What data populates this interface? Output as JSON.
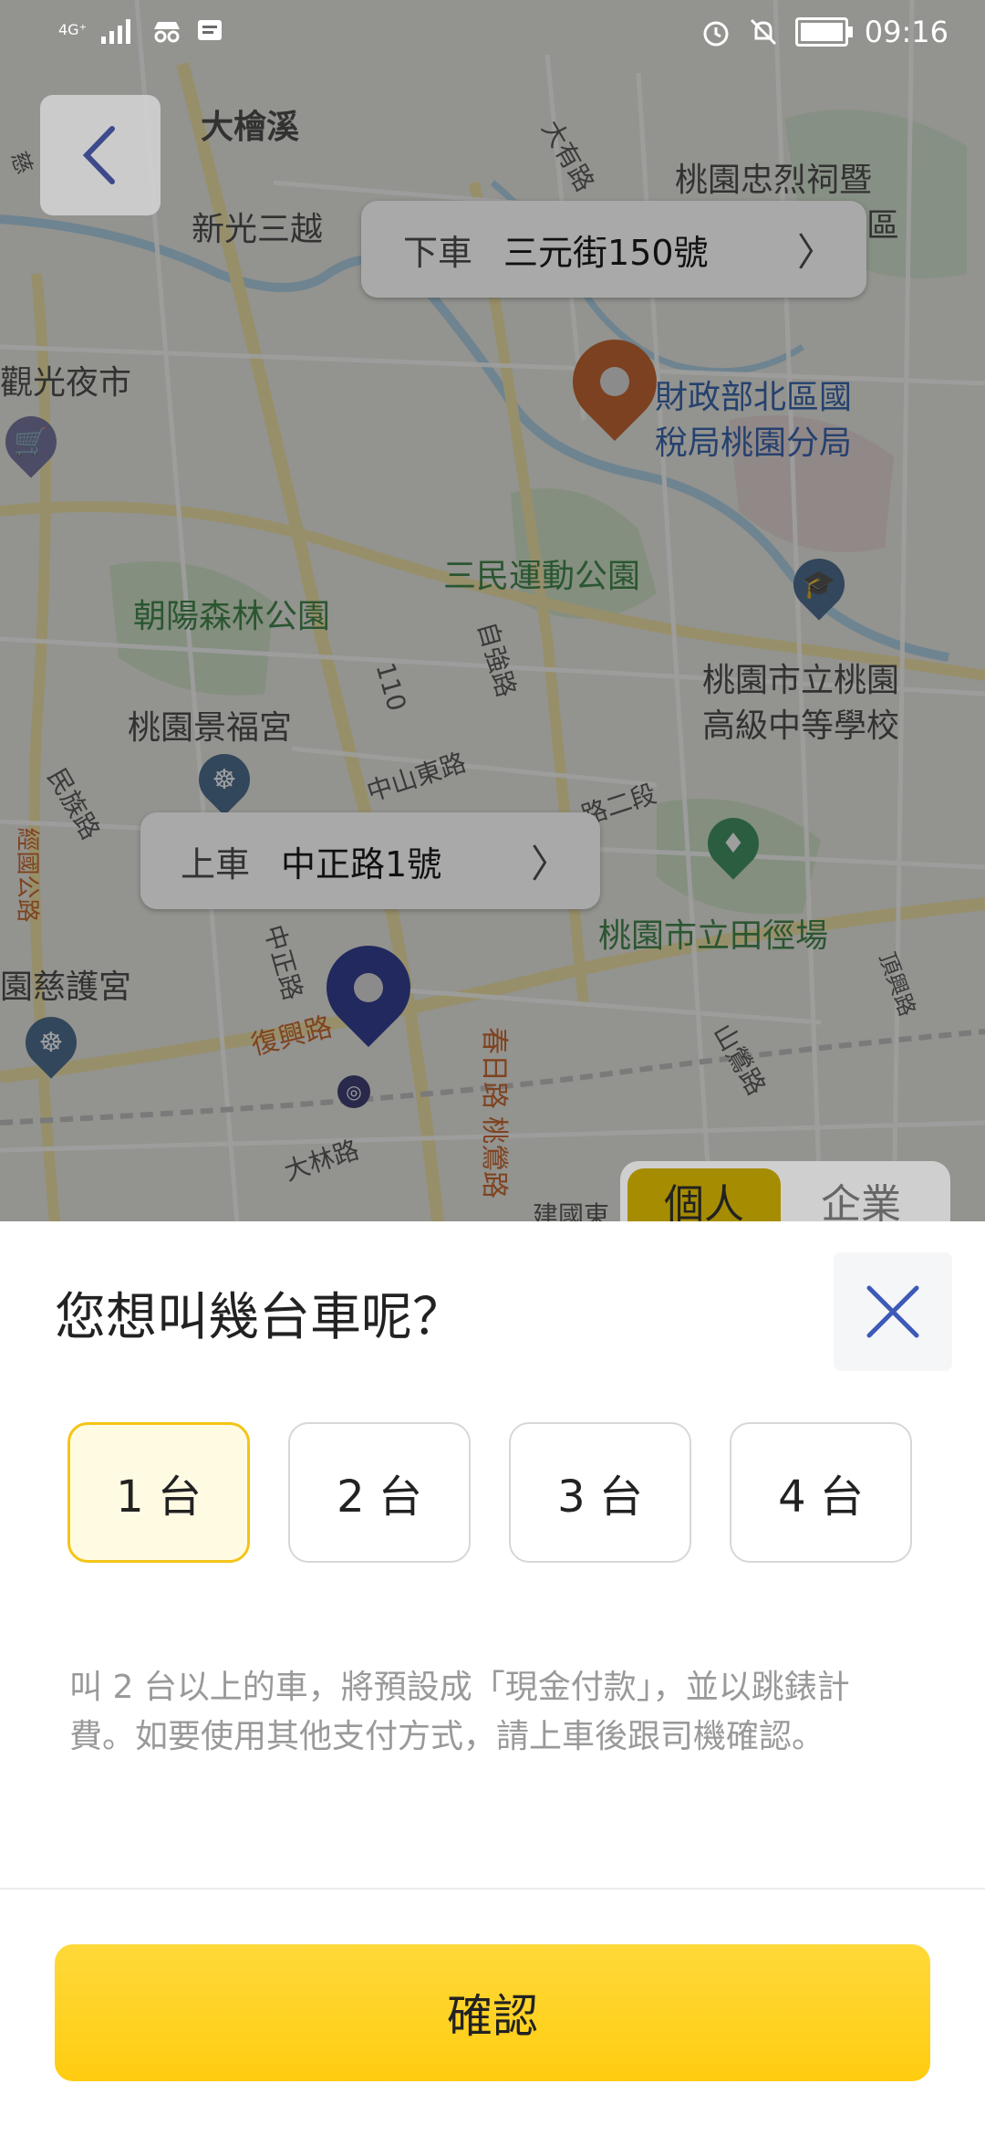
{
  "status_bar": {
    "network": "4G⁺",
    "time": "09:16",
    "icons": [
      "signal-icon",
      "incognito-icon",
      "message-icon",
      "alarm-icon",
      "mute-icon",
      "battery-icon"
    ]
  },
  "map": {
    "labels": {
      "da_jian_xi": "大檜溪",
      "xin_guang": "新光三越",
      "zhong_lie": "桃園忠烈祠暨",
      "zhong_lie_2": "區",
      "guan_guang": "觀光夜市",
      "cai_zheng_1": "財政部北區國",
      "cai_zheng_2": "稅局桃園分局",
      "san_min": "三民運動公園",
      "zhao_yang": "朝陽森林公園",
      "tao_yuan_school_1": "桃園市立桃園",
      "tao_yuan_school_2": "高級中等學校",
      "jing_fu": "桃園景福宮",
      "tian_jing": "桃園市立田徑場",
      "ci_hu": "園慈護宮",
      "fu_xing": "復興路",
      "min_zu": "民族路",
      "zhong_shan_east": "中山東路",
      "zi_qiang": "自強路",
      "road_110": "110",
      "er_duan": "路二段",
      "zhong_zheng": "中正路",
      "chun_ri": "春日路",
      "tao_ying": "桃鶯路",
      "da_lin": "大林路",
      "shan_ying": "山鶯路",
      "da_you": "大有路",
      "jian_guo": "建國東",
      "ding_xing": "頂興路",
      "ci": "慈",
      "wei_hua": "經國公路"
    }
  },
  "dropoff": {
    "tag": "下車",
    "address": "三元街150號",
    "chevron": "〉"
  },
  "pickup": {
    "tag": "上車",
    "address": "中正路1號",
    "chevron": "〉"
  },
  "tabs_peek": {
    "personal": "個人",
    "business": "企業"
  },
  "sheet": {
    "title": "您想叫幾台車呢？",
    "options": [
      {
        "label": "1 台",
        "selected": true
      },
      {
        "label": "2 台",
        "selected": false
      },
      {
        "label": "3 台",
        "selected": false
      },
      {
        "label": "4 台",
        "selected": false
      }
    ],
    "note": "叫 2 台以上的車，將預設成「現金付款」，並以跳錶計費。如要使用其他支付方式，請上車後跟司機確認。",
    "confirm_label": "確認"
  },
  "colors": {
    "accent_yellow": "#FFD12A",
    "selected_bg": "#FFFBE3",
    "close_blue": "#3D5AB8",
    "pickup_pin": "#1E2B8C",
    "dropoff_pin": "#C2561A"
  }
}
